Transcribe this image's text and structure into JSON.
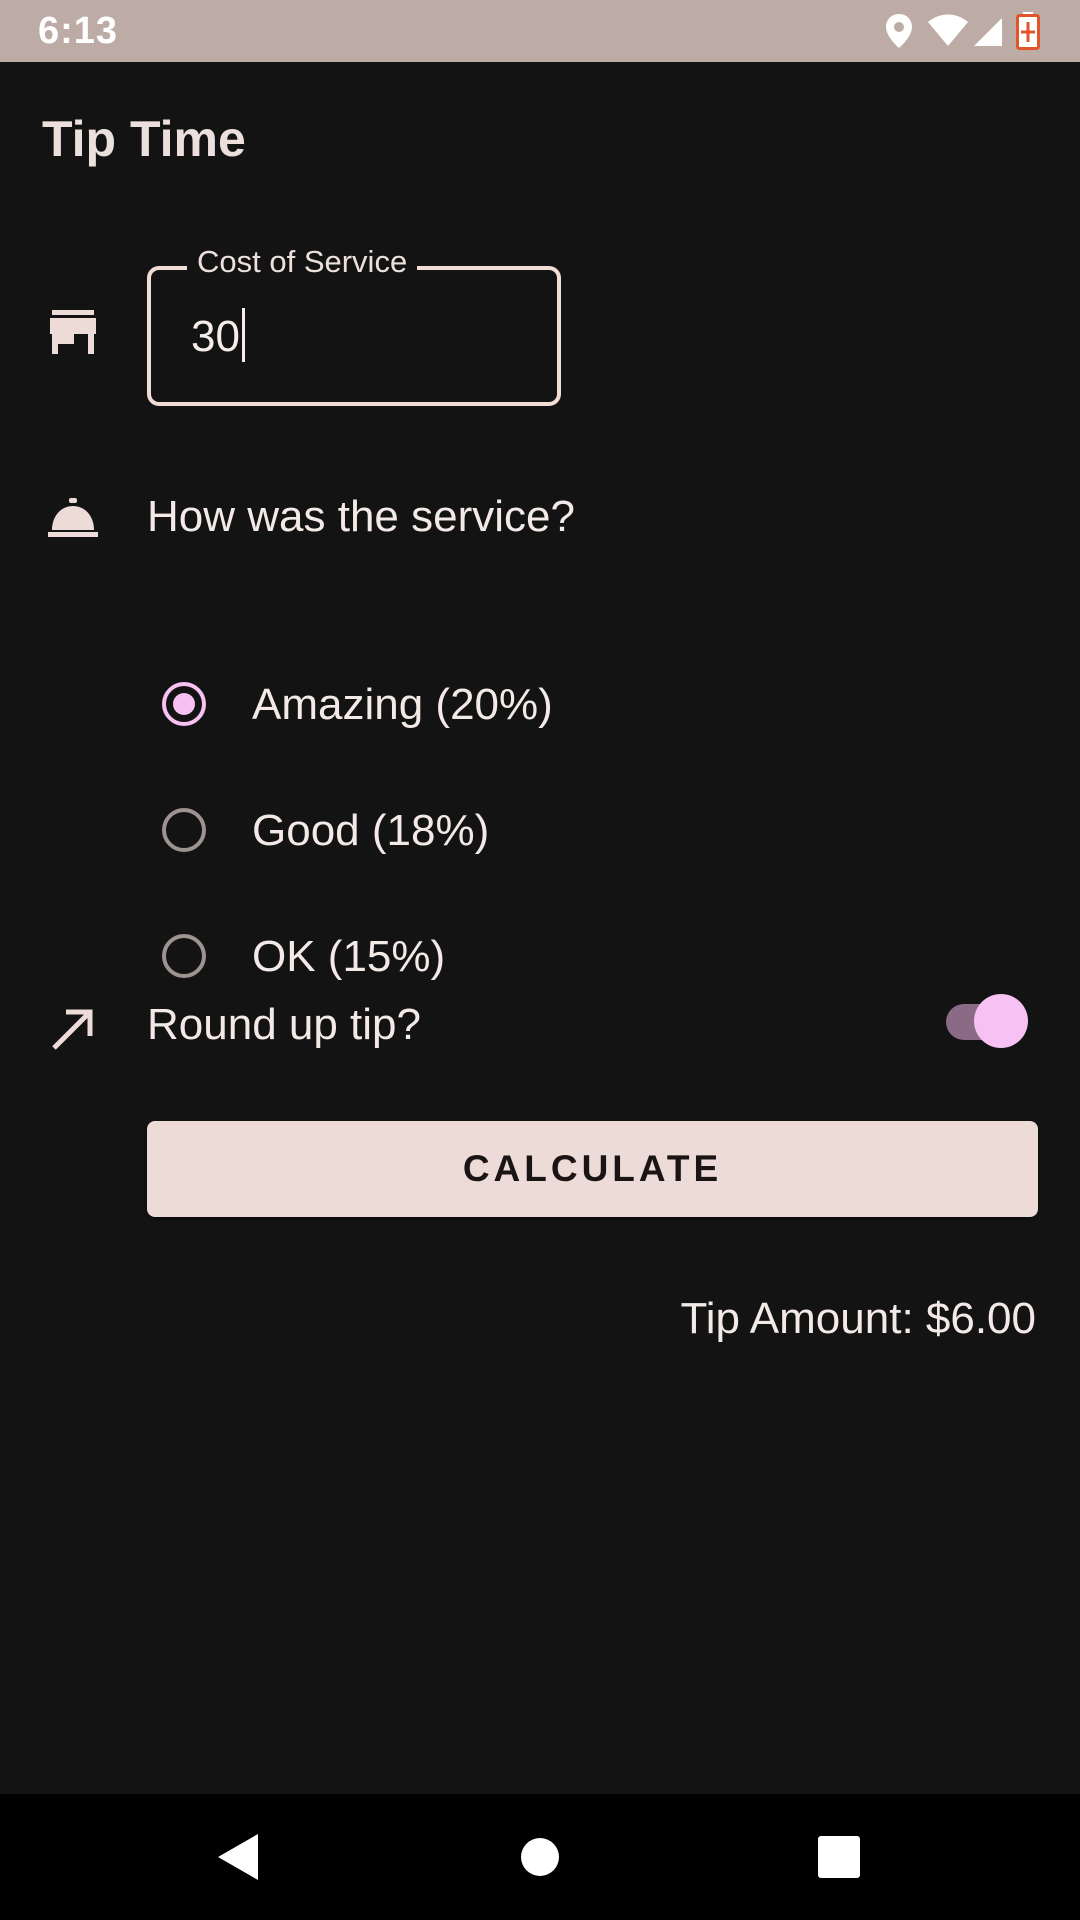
{
  "status_bar": {
    "time": "6:13",
    "icons": [
      "location-icon",
      "wifi-icon",
      "signal-icon",
      "battery-charging-icon"
    ]
  },
  "app": {
    "title": "Tip Time"
  },
  "cost_field": {
    "label": "Cost of Service",
    "value": "30",
    "icon": "storefront-icon"
  },
  "service": {
    "question": "How was the service?",
    "icon": "room-service-bell-icon",
    "options": [
      {
        "label": "Amazing (20%)",
        "selected": true
      },
      {
        "label": "Good (18%)",
        "selected": false
      },
      {
        "label": "OK (15%)",
        "selected": false
      }
    ]
  },
  "round_up": {
    "label": "Round up tip?",
    "icon": "trending-up-arrow-icon",
    "enabled": true
  },
  "calculate_button": {
    "label": "CALCULATE"
  },
  "result": {
    "text": "Tip Amount: $6.00"
  },
  "nav": {
    "icons": [
      "back-icon",
      "home-icon",
      "recents-icon"
    ]
  },
  "colors": {
    "background": "#131313",
    "status_bar": "#bdaba5",
    "accent": "#f7c1f3",
    "button": "#ecdbd6",
    "text": "#f3e9e6"
  }
}
